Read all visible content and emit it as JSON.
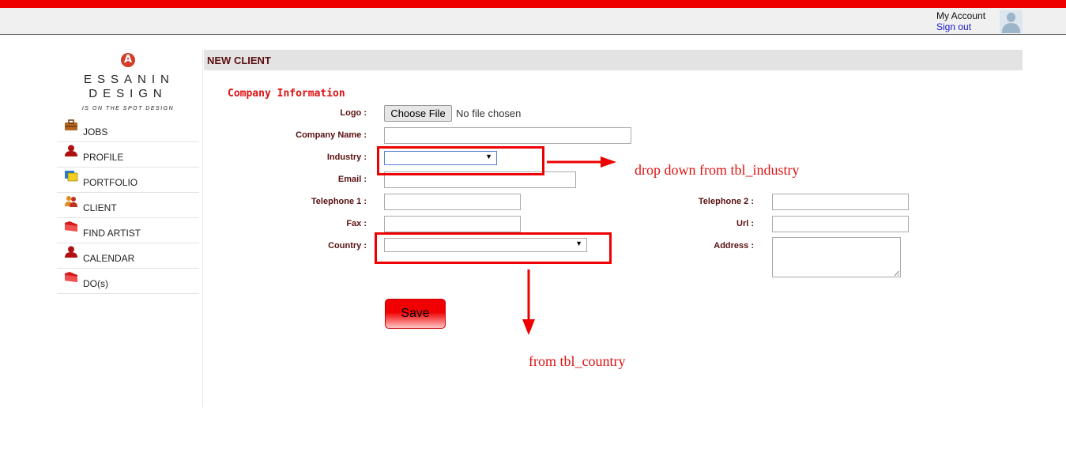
{
  "topbar": {
    "account_label": "My Account",
    "signout_label": "Sign out"
  },
  "logo": {
    "line1": "ESSANIN",
    "line2": "DESIGN",
    "tagline": "IS ON THE SPOT DESIGN",
    "mark": "A"
  },
  "sidebar": {
    "items": [
      {
        "label": "JOBS",
        "icon": "briefcase-icon"
      },
      {
        "label": "PROFILE",
        "icon": "user-icon"
      },
      {
        "label": "PORTFOLIO",
        "icon": "portfolio-icon"
      },
      {
        "label": "CLIENT",
        "icon": "client-icon"
      },
      {
        "label": "FIND ARTIST",
        "icon": "folder-icon"
      },
      {
        "label": "CALENDAR",
        "icon": "user-icon"
      },
      {
        "label": "DO(s)",
        "icon": "folder-icon"
      }
    ]
  },
  "page": {
    "title": "NEW CLIENT",
    "section_title": "Company Information"
  },
  "form": {
    "logo_label": "Logo :",
    "choose_file_label": "Choose File",
    "no_file_label": "No file chosen",
    "company_name_label": "Company Name :",
    "industry_label": "Industry :",
    "email_label": "Email :",
    "telephone1_label": "Telephone 1 :",
    "fax_label": "Fax :",
    "country_label": "Country :",
    "telephone2_label": "Telephone 2 :",
    "url_label": "Url :",
    "address_label": "Address :",
    "save_label": "Save"
  },
  "annotations": {
    "industry_note": "drop down from tbl_industry",
    "country_note": "from tbl_country"
  },
  "colors": {
    "brand_red": "#ee0000",
    "label_color": "#5a1010",
    "annotation_red": "#dd1111"
  }
}
